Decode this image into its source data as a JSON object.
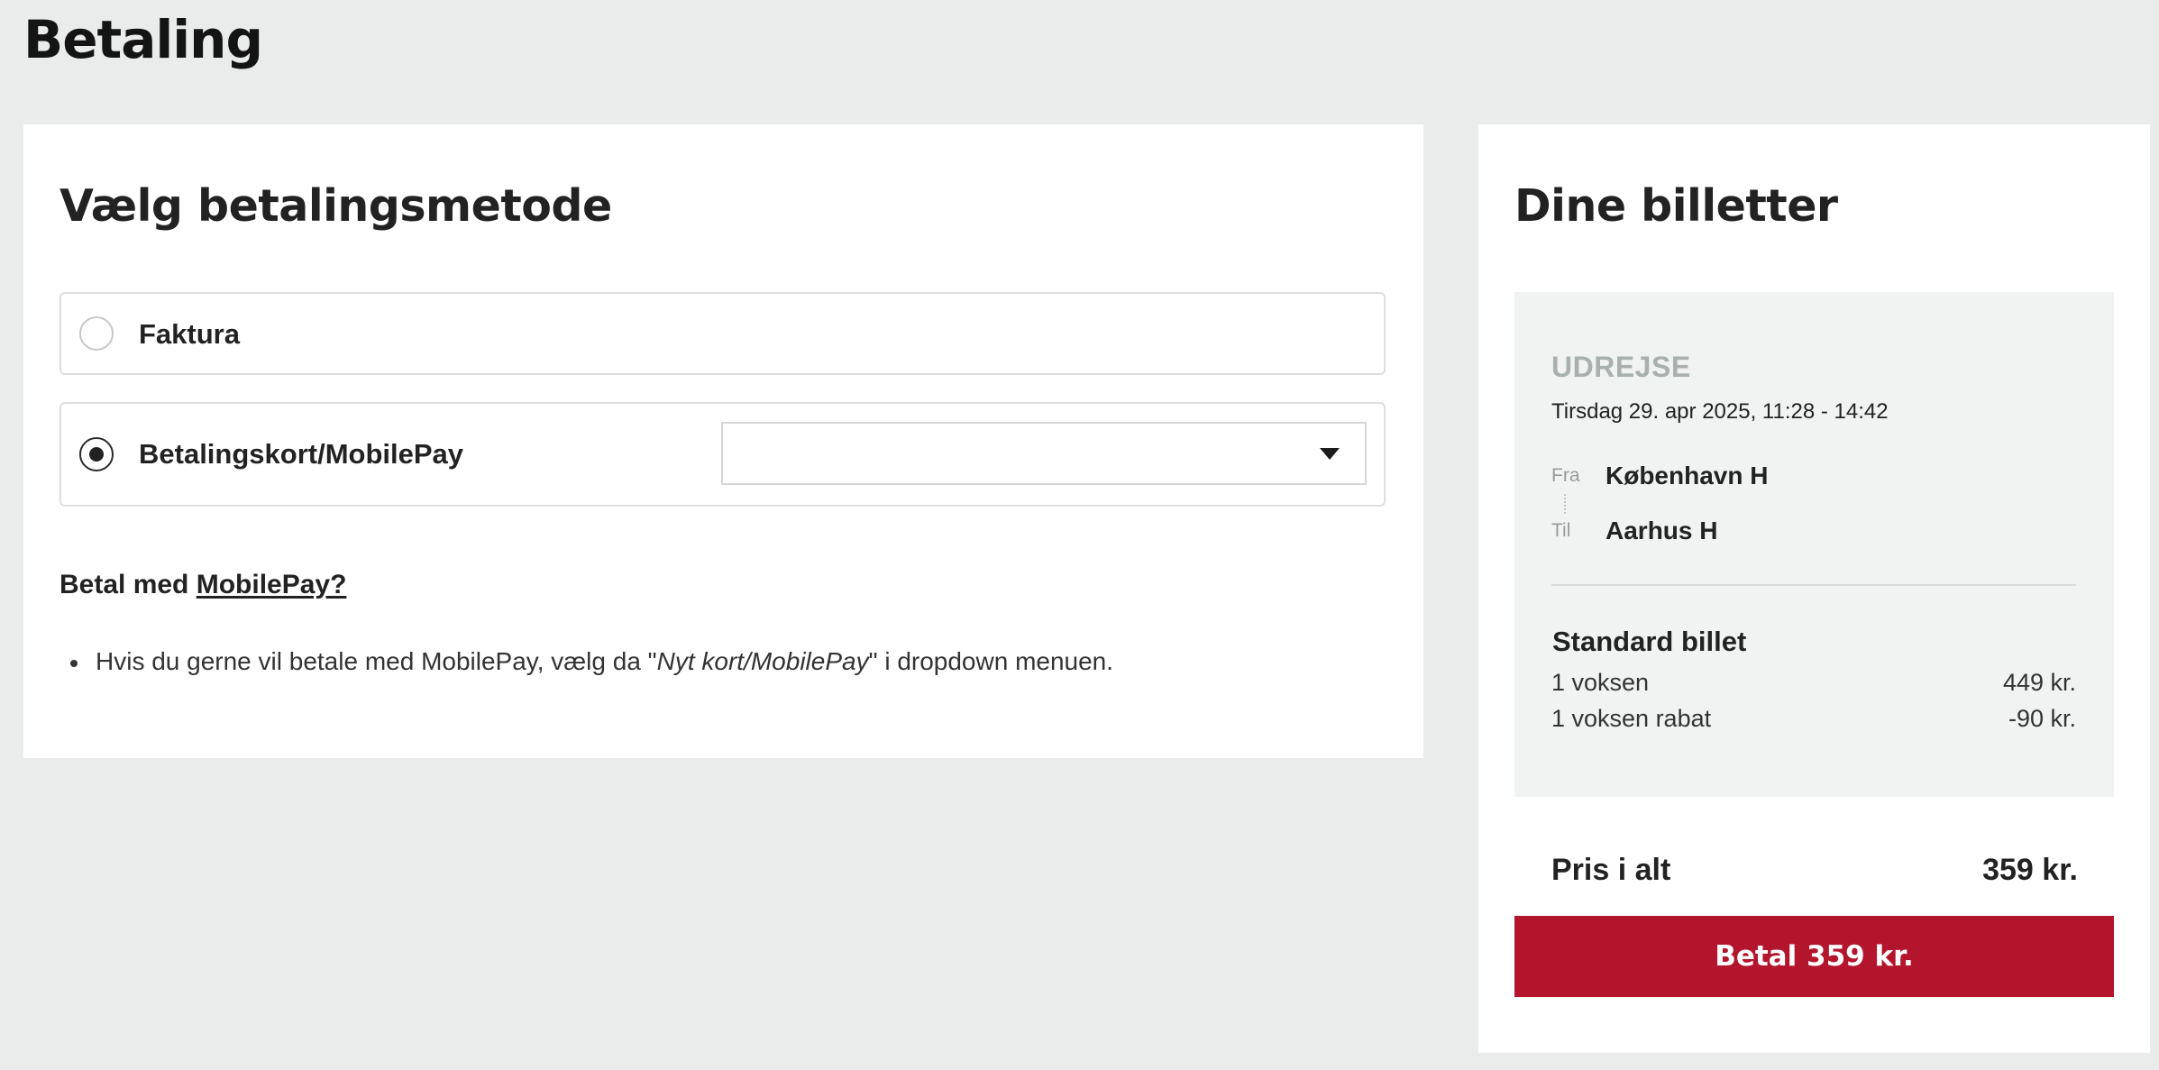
{
  "page": {
    "title": "Betaling"
  },
  "payment": {
    "heading": "Vælg betalingsmetode",
    "options": [
      {
        "label": "Faktura",
        "selected": false
      },
      {
        "label": "Betalingskort/MobilePay",
        "selected": true
      }
    ],
    "card_select_value": "",
    "mobilepay_question_prefix": "Betal med",
    "mobilepay_link": "MobilePay?",
    "hint_before": "Hvis du gerne vil betale med MobilePay, vælg da \"",
    "hint_emphasis": "Nyt kort/MobilePay",
    "hint_after": "\" i dropdown menuen."
  },
  "tickets": {
    "heading": "Dine billetter",
    "direction": "UDREJSE",
    "date": "Tirsdag 29. apr 2025, 11:28 - 14:42",
    "from_label": "Fra",
    "from": "København H",
    "to_label": "Til",
    "to": "Aarhus H",
    "ticket_type": "Standard billet",
    "lines": [
      {
        "label": "1 voksen",
        "price": "449 kr."
      },
      {
        "label": "1 voksen rabat",
        "price": "-90 kr."
      }
    ],
    "total_label": "Pris i alt",
    "total_value": "359 kr.",
    "pay_button": "Betal 359 kr."
  },
  "colors": {
    "background": "#e9eceb",
    "pay_button": "#b3162c",
    "direction_label": "#a8b1ad"
  }
}
